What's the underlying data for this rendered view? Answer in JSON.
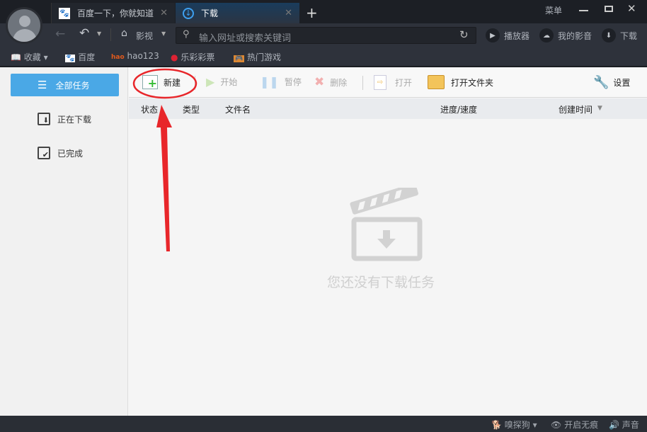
{
  "titlebar": {
    "tabs": [
      {
        "label": "百度一下，你就知道",
        "icon": "baidu-paw-icon"
      },
      {
        "label": "下载",
        "icon": "download-circle-icon",
        "active": true
      }
    ],
    "menu_label": "菜单"
  },
  "nav": {
    "home_label": "影视",
    "address_placeholder": "输入网址或搜索关键词",
    "right_buttons": [
      {
        "label": "播放器",
        "icon": "play-icon"
      },
      {
        "label": "我的影音",
        "icon": "cloud-icon"
      },
      {
        "label": "下载",
        "icon": "download-icon"
      }
    ]
  },
  "bookmarks": {
    "favorites_label": "收藏",
    "items": [
      {
        "label": "百度",
        "icon": "baidu-paw-icon"
      },
      {
        "label": "hao123",
        "icon": "hao123-icon"
      },
      {
        "label": "乐彩彩票",
        "icon": "lottery-icon"
      },
      {
        "label": "热门游戏",
        "icon": "gamepad-icon"
      }
    ]
  },
  "sidebar": {
    "items": [
      {
        "label": "全部任务",
        "active": true
      },
      {
        "label": "正在下载"
      },
      {
        "label": "已完成"
      }
    ]
  },
  "toolbar": {
    "new": "新建",
    "start": "开始",
    "pause": "暂停",
    "delete": "删除",
    "open": "打开",
    "open_folder": "打开文件夹",
    "settings": "设置"
  },
  "table": {
    "columns": [
      "状态",
      "类型",
      "文件名",
      "进度/速度",
      "创建时间"
    ]
  },
  "empty_message": "您还没有下载任务",
  "statusbar": {
    "sniffer": "嗅探狗",
    "incognito": "开启无痕",
    "sound": "声音"
  },
  "colors": {
    "accent": "#4aa8e6",
    "annotation": "#e8262a"
  }
}
